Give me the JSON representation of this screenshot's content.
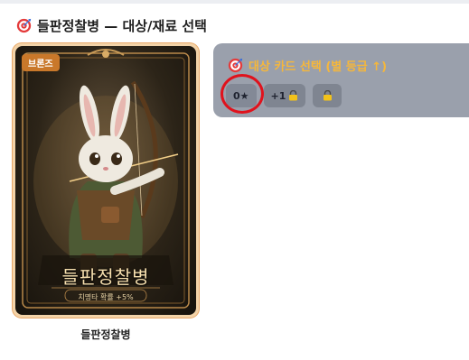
{
  "header": {
    "title": "들판정찰병 — 대상/재료 선택",
    "icon": "target-icon"
  },
  "card": {
    "rarity_badge": "브론즈",
    "name": "들판정찰병",
    "effect": "치명타 확률 +5%",
    "caption": "들판정찰병",
    "border_color": "#e9a868"
  },
  "panel": {
    "title": "대상 카드 선택 (별 등급 ↑)",
    "title_color": "#f6b73a",
    "buttons": [
      {
        "label": "0★",
        "locked": false,
        "selected": true
      },
      {
        "label": "+1",
        "locked": true
      },
      {
        "label": "",
        "locked": true
      }
    ]
  },
  "annotation": {
    "color": "#e0121c"
  }
}
